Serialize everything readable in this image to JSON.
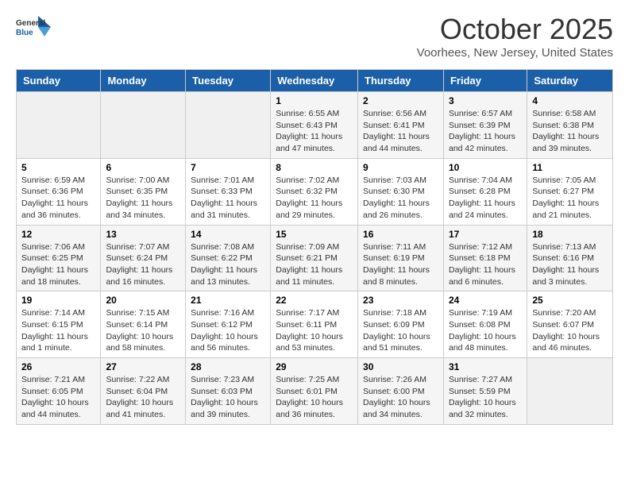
{
  "header": {
    "logo_general": "General",
    "logo_blue": "Blue",
    "title": "October 2025",
    "subtitle": "Voorhees, New Jersey, United States"
  },
  "calendar": {
    "weekdays": [
      "Sunday",
      "Monday",
      "Tuesday",
      "Wednesday",
      "Thursday",
      "Friday",
      "Saturday"
    ],
    "rows": [
      [
        {
          "day": "",
          "info": ""
        },
        {
          "day": "",
          "info": ""
        },
        {
          "day": "",
          "info": ""
        },
        {
          "day": "1",
          "info": "Sunrise: 6:55 AM\nSunset: 6:43 PM\nDaylight: 11 hours and 47 minutes."
        },
        {
          "day": "2",
          "info": "Sunrise: 6:56 AM\nSunset: 6:41 PM\nDaylight: 11 hours and 44 minutes."
        },
        {
          "day": "3",
          "info": "Sunrise: 6:57 AM\nSunset: 6:39 PM\nDaylight: 11 hours and 42 minutes."
        },
        {
          "day": "4",
          "info": "Sunrise: 6:58 AM\nSunset: 6:38 PM\nDaylight: 11 hours and 39 minutes."
        }
      ],
      [
        {
          "day": "5",
          "info": "Sunrise: 6:59 AM\nSunset: 6:36 PM\nDaylight: 11 hours and 36 minutes."
        },
        {
          "day": "6",
          "info": "Sunrise: 7:00 AM\nSunset: 6:35 PM\nDaylight: 11 hours and 34 minutes."
        },
        {
          "day": "7",
          "info": "Sunrise: 7:01 AM\nSunset: 6:33 PM\nDaylight: 11 hours and 31 minutes."
        },
        {
          "day": "8",
          "info": "Sunrise: 7:02 AM\nSunset: 6:32 PM\nDaylight: 11 hours and 29 minutes."
        },
        {
          "day": "9",
          "info": "Sunrise: 7:03 AM\nSunset: 6:30 PM\nDaylight: 11 hours and 26 minutes."
        },
        {
          "day": "10",
          "info": "Sunrise: 7:04 AM\nSunset: 6:28 PM\nDaylight: 11 hours and 24 minutes."
        },
        {
          "day": "11",
          "info": "Sunrise: 7:05 AM\nSunset: 6:27 PM\nDaylight: 11 hours and 21 minutes."
        }
      ],
      [
        {
          "day": "12",
          "info": "Sunrise: 7:06 AM\nSunset: 6:25 PM\nDaylight: 11 hours and 18 minutes."
        },
        {
          "day": "13",
          "info": "Sunrise: 7:07 AM\nSunset: 6:24 PM\nDaylight: 11 hours and 16 minutes."
        },
        {
          "day": "14",
          "info": "Sunrise: 7:08 AM\nSunset: 6:22 PM\nDaylight: 11 hours and 13 minutes."
        },
        {
          "day": "15",
          "info": "Sunrise: 7:09 AM\nSunset: 6:21 PM\nDaylight: 11 hours and 11 minutes."
        },
        {
          "day": "16",
          "info": "Sunrise: 7:11 AM\nSunset: 6:19 PM\nDaylight: 11 hours and 8 minutes."
        },
        {
          "day": "17",
          "info": "Sunrise: 7:12 AM\nSunset: 6:18 PM\nDaylight: 11 hours and 6 minutes."
        },
        {
          "day": "18",
          "info": "Sunrise: 7:13 AM\nSunset: 6:16 PM\nDaylight: 11 hours and 3 minutes."
        }
      ],
      [
        {
          "day": "19",
          "info": "Sunrise: 7:14 AM\nSunset: 6:15 PM\nDaylight: 11 hours and 1 minute."
        },
        {
          "day": "20",
          "info": "Sunrise: 7:15 AM\nSunset: 6:14 PM\nDaylight: 10 hours and 58 minutes."
        },
        {
          "day": "21",
          "info": "Sunrise: 7:16 AM\nSunset: 6:12 PM\nDaylight: 10 hours and 56 minutes."
        },
        {
          "day": "22",
          "info": "Sunrise: 7:17 AM\nSunset: 6:11 PM\nDaylight: 10 hours and 53 minutes."
        },
        {
          "day": "23",
          "info": "Sunrise: 7:18 AM\nSunset: 6:09 PM\nDaylight: 10 hours and 51 minutes."
        },
        {
          "day": "24",
          "info": "Sunrise: 7:19 AM\nSunset: 6:08 PM\nDaylight: 10 hours and 48 minutes."
        },
        {
          "day": "25",
          "info": "Sunrise: 7:20 AM\nSunset: 6:07 PM\nDaylight: 10 hours and 46 minutes."
        }
      ],
      [
        {
          "day": "26",
          "info": "Sunrise: 7:21 AM\nSunset: 6:05 PM\nDaylight: 10 hours and 44 minutes."
        },
        {
          "day": "27",
          "info": "Sunrise: 7:22 AM\nSunset: 6:04 PM\nDaylight: 10 hours and 41 minutes."
        },
        {
          "day": "28",
          "info": "Sunrise: 7:23 AM\nSunset: 6:03 PM\nDaylight: 10 hours and 39 minutes."
        },
        {
          "day": "29",
          "info": "Sunrise: 7:25 AM\nSunset: 6:01 PM\nDaylight: 10 hours and 36 minutes."
        },
        {
          "day": "30",
          "info": "Sunrise: 7:26 AM\nSunset: 6:00 PM\nDaylight: 10 hours and 34 minutes."
        },
        {
          "day": "31",
          "info": "Sunrise: 7:27 AM\nSunset: 5:59 PM\nDaylight: 10 hours and 32 minutes."
        },
        {
          "day": "",
          "info": ""
        }
      ]
    ]
  }
}
